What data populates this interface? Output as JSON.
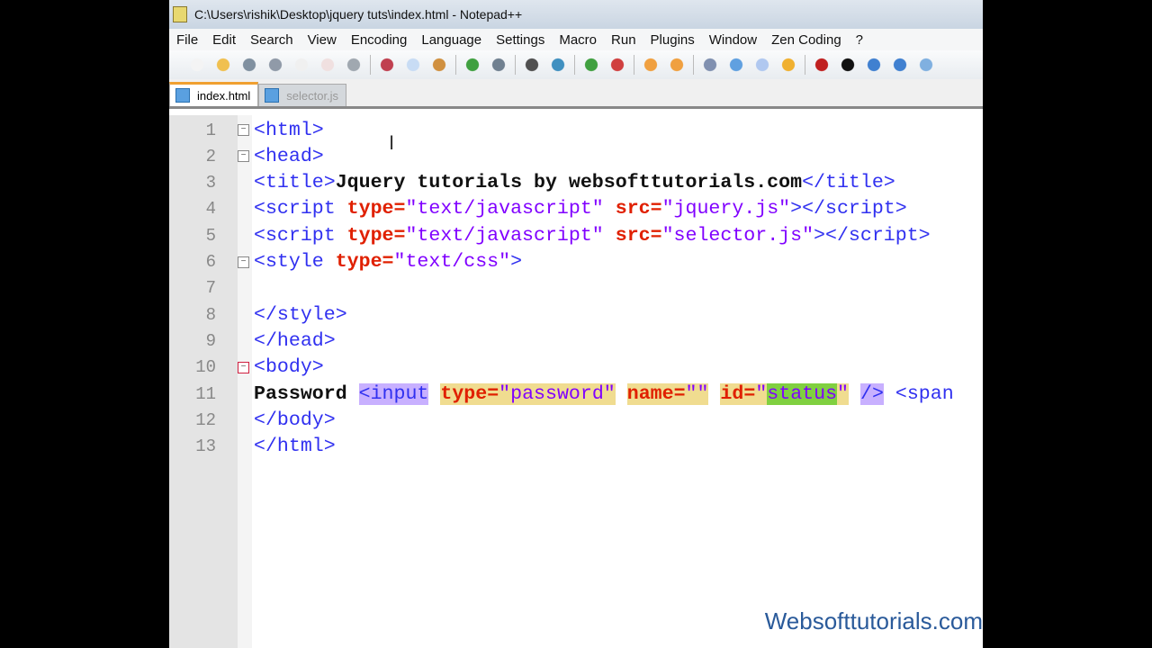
{
  "window": {
    "title": "C:\\Users\\rishik\\Desktop\\jquery tuts\\index.html - Notepad++"
  },
  "menu": [
    "File",
    "Edit",
    "Search",
    "View",
    "Encoding",
    "Language",
    "Settings",
    "Macro",
    "Run",
    "Plugins",
    "Window",
    "Zen Coding",
    "?"
  ],
  "tabs": [
    {
      "label": "index.html",
      "active": true
    },
    {
      "label": "selector.js",
      "active": false
    }
  ],
  "code": [
    {
      "n": "1",
      "fold": "⊟",
      "tokens": [
        [
          "<html>",
          "t",
          ""
        ]
      ]
    },
    {
      "n": "2",
      "fold": "⊟",
      "tokens": [
        [
          "<head>",
          "t",
          ""
        ]
      ]
    },
    {
      "n": "3",
      "fold": "",
      "tokens": [
        [
          "<title>",
          "t",
          ""
        ],
        [
          "Jquery tutorials by websofttutorials.com",
          "x",
          ""
        ],
        [
          "</title>",
          "t",
          ""
        ]
      ]
    },
    {
      "n": "4",
      "fold": "",
      "tokens": [
        [
          "<script ",
          "t",
          ""
        ],
        [
          "type=",
          "a",
          ""
        ],
        [
          "\"text/javascript\" ",
          "v",
          ""
        ],
        [
          "src=",
          "a",
          ""
        ],
        [
          "\"jquery.js\"",
          "v",
          ""
        ],
        [
          "></script>",
          "t",
          ""
        ]
      ]
    },
    {
      "n": "5",
      "fold": "",
      "tokens": [
        [
          "<script ",
          "t",
          ""
        ],
        [
          "type=",
          "a",
          ""
        ],
        [
          "\"text/javascript\" ",
          "v",
          ""
        ],
        [
          "src=",
          "a",
          ""
        ],
        [
          "\"selector.js\"",
          "v",
          ""
        ],
        [
          "></script>",
          "t",
          ""
        ]
      ]
    },
    {
      "n": "6",
      "fold": "⊟",
      "tokens": [
        [
          "<style ",
          "t",
          ""
        ],
        [
          "type=",
          "a",
          ""
        ],
        [
          "\"text/css\"",
          "v",
          ""
        ],
        [
          ">",
          "t",
          ""
        ]
      ]
    },
    {
      "n": "7",
      "fold": "",
      "tokens": []
    },
    {
      "n": "8",
      "fold": "",
      "tokens": [
        [
          "</style>",
          "t",
          ""
        ]
      ]
    },
    {
      "n": "9",
      "fold": "",
      "tokens": [
        [
          "</head>",
          "t",
          ""
        ]
      ]
    },
    {
      "n": "10",
      "fold": "⊟",
      "tokens": [
        [
          "<body>",
          "t",
          ""
        ]
      ]
    },
    {
      "n": "11",
      "fold": "",
      "tokens": [
        [
          "Password ",
          "x",
          ""
        ],
        [
          "<input",
          "t",
          "hlp"
        ],
        [
          " ",
          "x",
          ""
        ],
        [
          "type=",
          "a",
          "hly"
        ],
        [
          "\"password\"",
          "v",
          "hly"
        ],
        [
          " ",
          "x",
          ""
        ],
        [
          "name=",
          "a",
          "hly"
        ],
        [
          "\"\"",
          "v",
          "hly"
        ],
        [
          " ",
          "x",
          ""
        ],
        [
          "id=",
          "a",
          "hly"
        ],
        [
          "\"",
          "v",
          "hly"
        ],
        [
          "status",
          "v",
          "hlg"
        ],
        [
          "\"",
          "v",
          "hly"
        ],
        [
          " ",
          "x",
          ""
        ],
        [
          "/>",
          "t",
          "hlp"
        ],
        [
          " <span",
          "t",
          ""
        ]
      ]
    },
    {
      "n": "12",
      "fold": "",
      "tokens": [
        [
          "</body>",
          "t",
          ""
        ]
      ]
    },
    {
      "n": "13",
      "fold": "",
      "tokens": [
        [
          "</html>",
          "t",
          ""
        ]
      ]
    }
  ],
  "watermark": "Websofttutorials.com"
}
